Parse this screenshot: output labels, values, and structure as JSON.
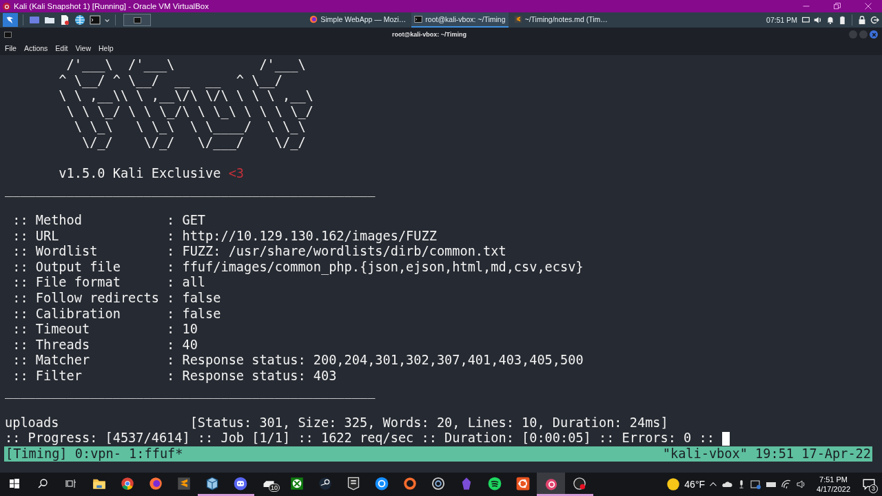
{
  "vm_window": {
    "title": "Kali (Kali Snapshot 1) [Running] - Oracle VM VirtualBox"
  },
  "kali_panel": {
    "tasks": [
      {
        "label": "Simple WebApp — Mozi…",
        "kind": "firefox",
        "selected": false
      },
      {
        "label": "root@kali-vbox: ~/Timing",
        "kind": "terminal",
        "selected": true
      },
      {
        "label": "~/Timing/notes.md (Tim…",
        "kind": "editor",
        "selected": false
      }
    ],
    "clock": "07:51 PM"
  },
  "terminal": {
    "title": "root@kali-vbox: ~/Timing",
    "menu": [
      "File",
      "Actions",
      "Edit",
      "View",
      "Help"
    ],
    "banner": [
      "        /'___\\  /'___\\           /'___\\",
      "       ^ \\__/ ^ \\__/  __  __  ^ \\__/",
      "       \\ \\ ,__\\\\ \\ ,__\\/\\ \\/\\ \\ \\ \\ ,__\\",
      "        \\ \\ \\_/ \\ \\ \\_/\\ \\ \\_\\ \\ \\ \\ \\_/",
      "         \\ \\_\\   \\ \\_\\  \\ \\____/  \\ \\_\\",
      "          \\/_/    \\/_/   \\/___/    \\/_/"
    ],
    "version": "       v1.5.0 Kali Exclusive ",
    "heart": "<3",
    "rule": "________________________________________________",
    "options": [
      " :: Method           : GET",
      " :: URL              : http://10.129.130.162/images/FUZZ",
      " :: Wordlist         : FUZZ: /usr/share/wordlists/dirb/common.txt",
      " :: Output file      : ffuf/images/common_php.{json,ejson,html,md,csv,ecsv}",
      " :: File format      : all",
      " :: Follow redirects : false",
      " :: Calibration      : false",
      " :: Timeout          : 10",
      " :: Threads          : 40",
      " :: Matcher          : Response status: 200,204,301,302,307,401,403,405,500",
      " :: Filter           : Response status: 403"
    ],
    "results": [
      "uploads                 [Status: 301, Size: 325, Words: 20, Lines: 10, Duration: 24ms]"
    ],
    "progress": ":: Progress: [4537/4614] :: Job [1/1] :: 1622 req/sec :: Duration: [0:00:05] :: Errors: 0 ::",
    "tmux": {
      "left": "[Timing] 0:vpn- 1:ffuf*",
      "right": "\"kali-vbox\" 19:51 17-Apr-22"
    }
  },
  "taskbar": {
    "apps": [
      {
        "kind": "folder",
        "running": false,
        "selected": false
      },
      {
        "kind": "chrome",
        "running": false,
        "selected": false
      },
      {
        "kind": "firefox",
        "running": false,
        "selected": false
      },
      {
        "kind": "sublime",
        "running": false,
        "selected": false
      },
      {
        "kind": "cube",
        "running": true,
        "selected": false
      },
      {
        "kind": "discord",
        "running": true,
        "selected": false
      },
      {
        "kind": "drive",
        "running": false,
        "selected": false,
        "badge": "10"
      },
      {
        "kind": "xbox",
        "running": false,
        "selected": false
      },
      {
        "kind": "steam",
        "running": false,
        "selected": false
      },
      {
        "kind": "epic",
        "running": false,
        "selected": false
      },
      {
        "kind": "battlenet",
        "running": false,
        "selected": false
      },
      {
        "kind": "origin",
        "running": false,
        "selected": false
      },
      {
        "kind": "ubisoft",
        "running": false,
        "selected": false
      },
      {
        "kind": "obsidian",
        "running": false,
        "selected": false
      },
      {
        "kind": "spotify",
        "running": false,
        "selected": false
      },
      {
        "kind": "ubuntu",
        "running": false,
        "selected": false
      },
      {
        "kind": "vbox",
        "running": true,
        "selected": true
      },
      {
        "kind": "obs",
        "running": true,
        "selected": false
      }
    ],
    "weather": "46°F",
    "time": "7:51 PM",
    "date": "4/17/2022",
    "notifications": "3"
  }
}
